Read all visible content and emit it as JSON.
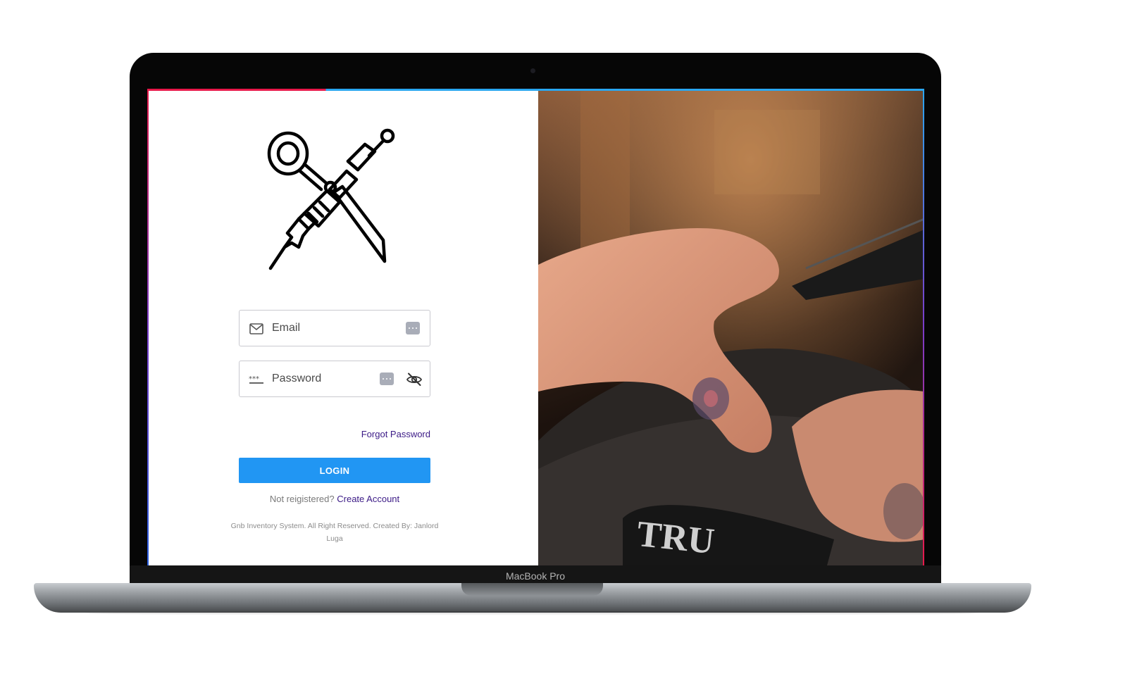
{
  "device": {
    "model_label": "MacBook Pro"
  },
  "login": {
    "email_placeholder": "Email",
    "password_placeholder": "Password",
    "forgot_password": "Forgot Password",
    "login_button": "LOGIN",
    "not_registered": "Not reigistered?",
    "create_account": "Create Account",
    "copyright": "Gnb Inventory System. All Right Reserved. Created By: Janlord Luga"
  },
  "icons": {
    "logo": "scissors-tattoo-machine-logo",
    "email_lead": "mail-icon",
    "password_lead": "password-dots-icon",
    "autofill": "autofill-key-icon",
    "visibility": "eye-off-icon"
  },
  "photo": {
    "brand_text": "TRU"
  },
  "colors": {
    "accent_blue": "#2196f3",
    "link_purple": "#3b1a86",
    "top_accent_red": "#e8194a",
    "top_accent_blue": "#2aa7f0"
  }
}
